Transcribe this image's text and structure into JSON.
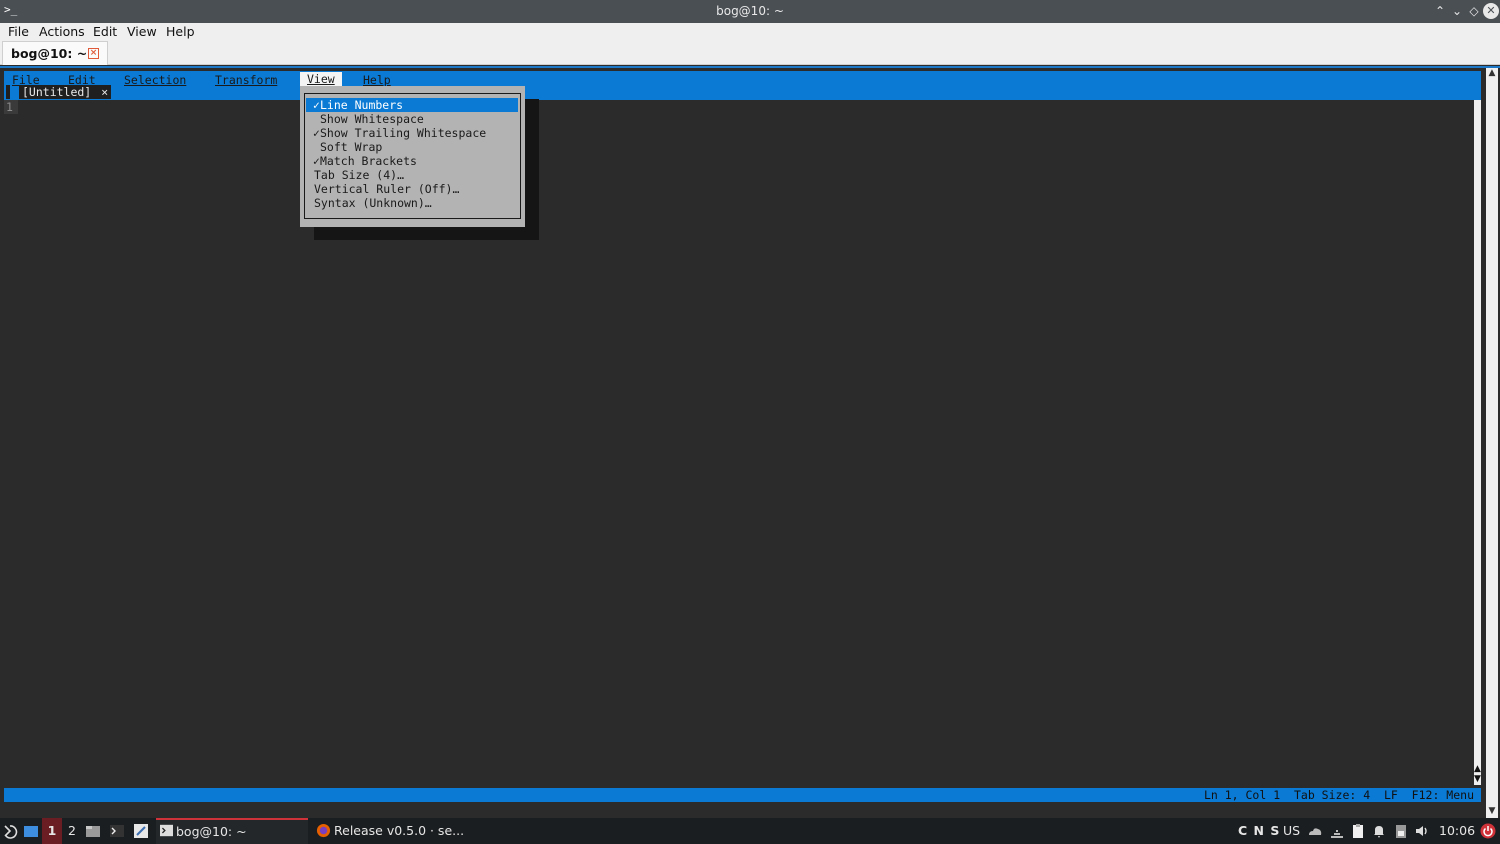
{
  "window": {
    "icon": ">_",
    "title": "bog@10: ~",
    "controls": [
      "⌃",
      "⌄",
      "◇",
      "✕"
    ]
  },
  "app_menu": [
    "File",
    "Actions",
    "Edit",
    "View",
    "Help"
  ],
  "tab": {
    "label": "bog@10: ~",
    "close": "×"
  },
  "micro": {
    "menus": [
      "File",
      "Edit",
      "Selection",
      "Transform",
      "View",
      "Help"
    ],
    "active_menu": "View",
    "file_tab": "[Untitled]",
    "file_tab_close": "×",
    "gutter_line": "1",
    "view_menu": [
      {
        "check": "✓",
        "label": "Line Numbers",
        "selected": true,
        "indent": true
      },
      {
        "check": "",
        "label": "Show Whitespace",
        "indent": true
      },
      {
        "check": "✓",
        "label": "Show Trailing Whitespace",
        "indent": true
      },
      {
        "check": "",
        "label": "Soft Wrap",
        "indent": true
      },
      {
        "check": "✓",
        "label": "Match Brackets",
        "indent": true
      },
      {
        "check": "",
        "label": "Tab Size (4)…",
        "indent": false
      },
      {
        "check": "",
        "label": "Vertical Ruler (Off)…",
        "indent": false
      },
      {
        "check": "",
        "label": "Syntax (Unknown)…",
        "indent": false
      }
    ],
    "status": "Ln 1, Col 1  Tab Size: 4  LF  F12: Menu"
  },
  "taskbar": {
    "workspaces": [
      "1",
      "2"
    ],
    "tasks": [
      "bog@10: ~",
      "Release v0.5.0 · se..."
    ],
    "tray_letters": "C N S",
    "keyboard": "US",
    "clock": "10:06"
  },
  "colors": {
    "accent": "#0a7ad4",
    "terminal_bg": "#2b2b2b",
    "menu_bg": "#b3b3b3",
    "taskbar_bg": "#1b1e20",
    "active_workspace": "#6a1d22"
  }
}
